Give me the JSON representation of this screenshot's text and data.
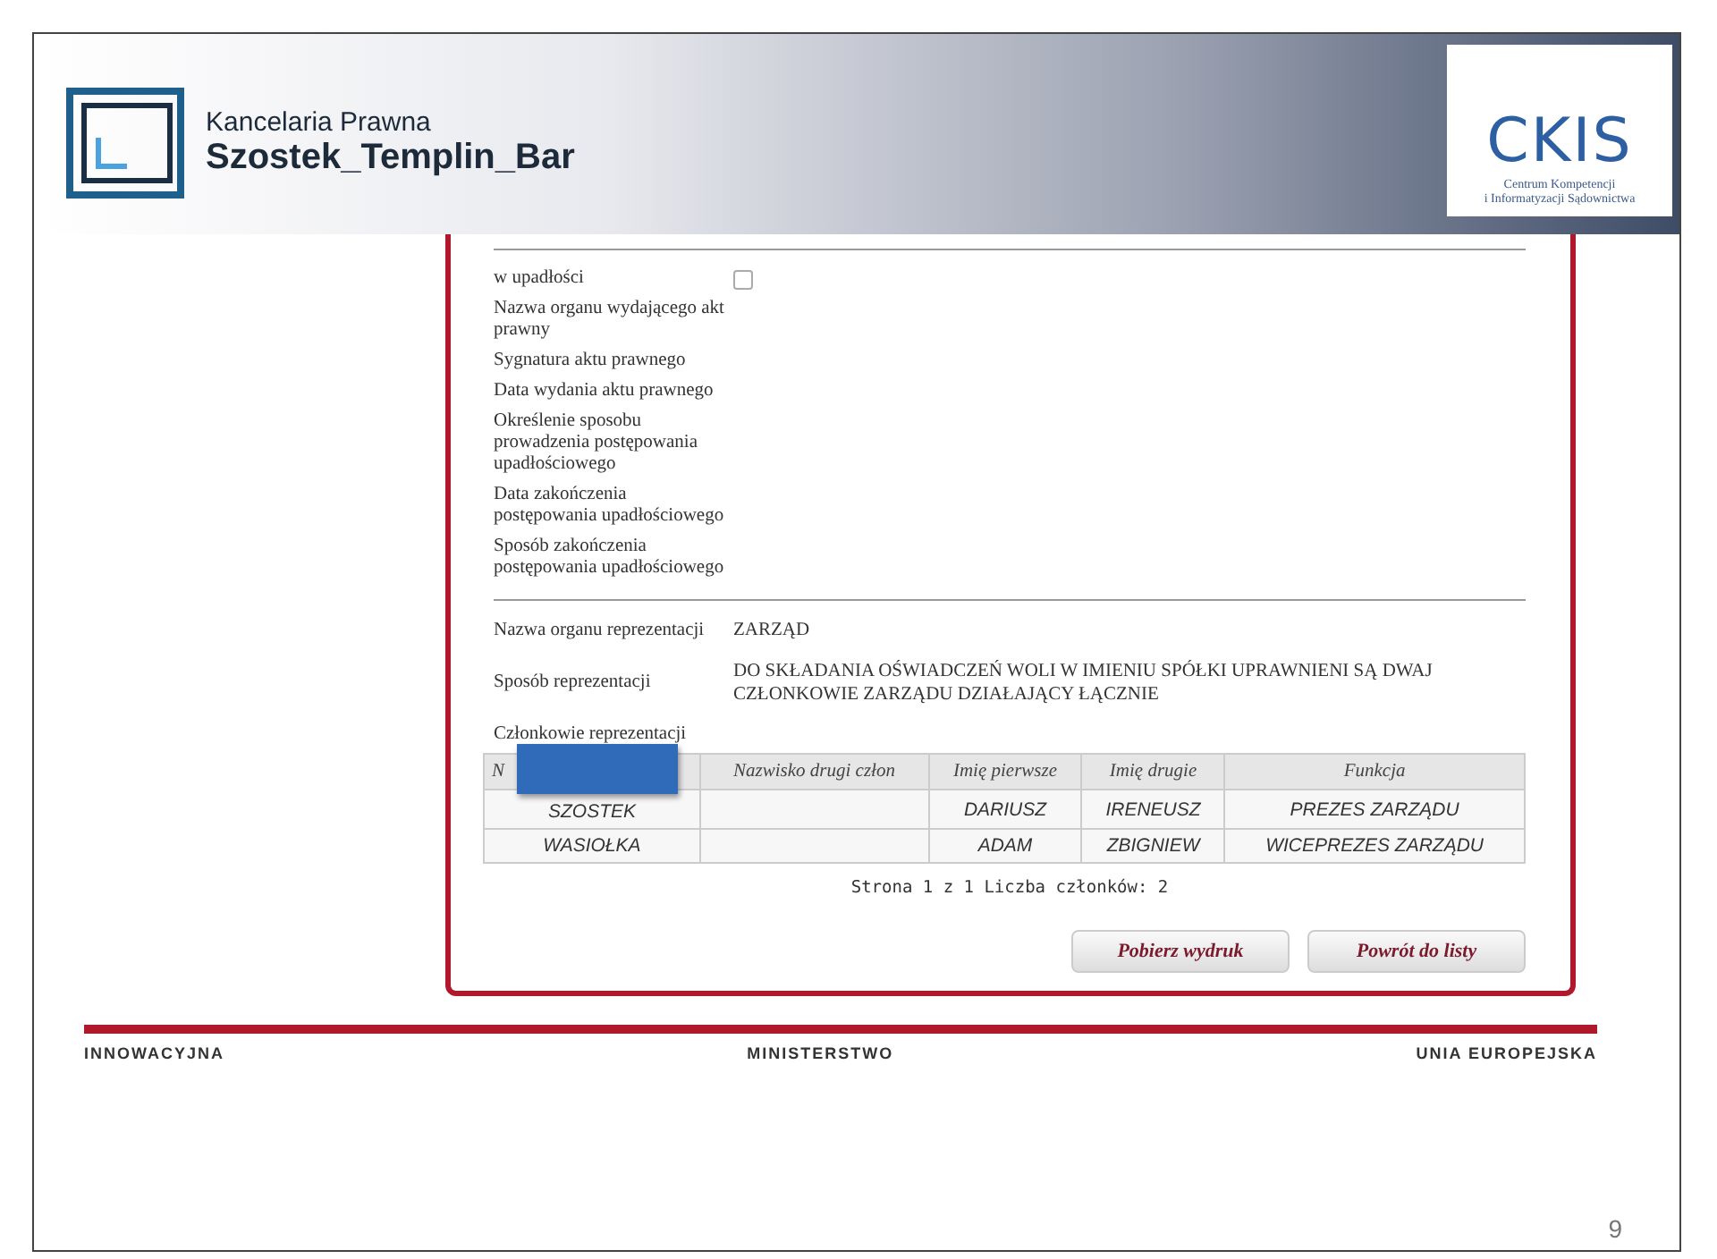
{
  "header": {
    "brand_line_1": "Kancelaria Prawna",
    "brand_line_2": "Szostek_Templin_Bar",
    "partner_logo": {
      "name": "CKIS",
      "line_1": "Centrum Kompetencji",
      "line_2": "i Informatyzacji Sądownictwa"
    }
  },
  "bankruptcy": {
    "fields": [
      {
        "kind": "checkbox",
        "label": "w upadłości",
        "checked": false
      },
      {
        "kind": "text",
        "label": "Nazwa organu wydającego akt prawny"
      },
      {
        "kind": "text",
        "label": "Sygnatura aktu prawnego"
      },
      {
        "kind": "text",
        "label": "Data wydania aktu prawnego"
      },
      {
        "kind": "text",
        "label": "Określenie sposobu prowadzenia postępowania upadłościowego"
      },
      {
        "kind": "text",
        "label": "Data zakończenia postępowania upadłościowego"
      },
      {
        "kind": "text",
        "label": "Sposób zakończenia postępowania upadłościowego"
      }
    ]
  },
  "representation": {
    "fields": [
      {
        "label": "Nazwa organu reprezentacji",
        "value": "ZARZĄD"
      },
      {
        "label": "Sposób reprezentacji",
        "value": "DO SKŁADANIA OŚWIADCZEŃ WOLI W IMIENIU SPÓŁKI UPRAWNIENI SĄ DWAJ CZŁONKOWIE ZARZĄDU DZIAŁAJĄCY ŁĄCZNIE"
      }
    ],
    "members_label": "Członkowie reprezentacji",
    "table": {
      "columns": [
        {
          "label": "N",
          "redacted": true
        },
        {
          "label": "Nazwisko drugi człon",
          "redacted": false
        },
        {
          "label": "Imię pierwsze",
          "redacted": false
        },
        {
          "label": "Imię drugie",
          "redacted": false
        },
        {
          "label": "Funkcja",
          "redacted": false
        }
      ],
      "rows": [
        [
          "SZOSTEK",
          "",
          "DARIUSZ",
          "IRENEUSZ",
          "PREZES ZARZĄDU"
        ],
        [
          "WASIOŁKA",
          "",
          "ADAM",
          "ZBIGNIEW",
          "WICEPREZES ZARZĄDU"
        ]
      ]
    },
    "pager": "Strona 1 z 1 Liczba członków: 2"
  },
  "buttons": [
    "Pobierz wydruk",
    "Powrót do listy"
  ],
  "footer_logos": [
    "INNOWACYJNA",
    "MINISTERSTWO",
    "UNIA EUROPEJSKA"
  ],
  "page_number": "9"
}
